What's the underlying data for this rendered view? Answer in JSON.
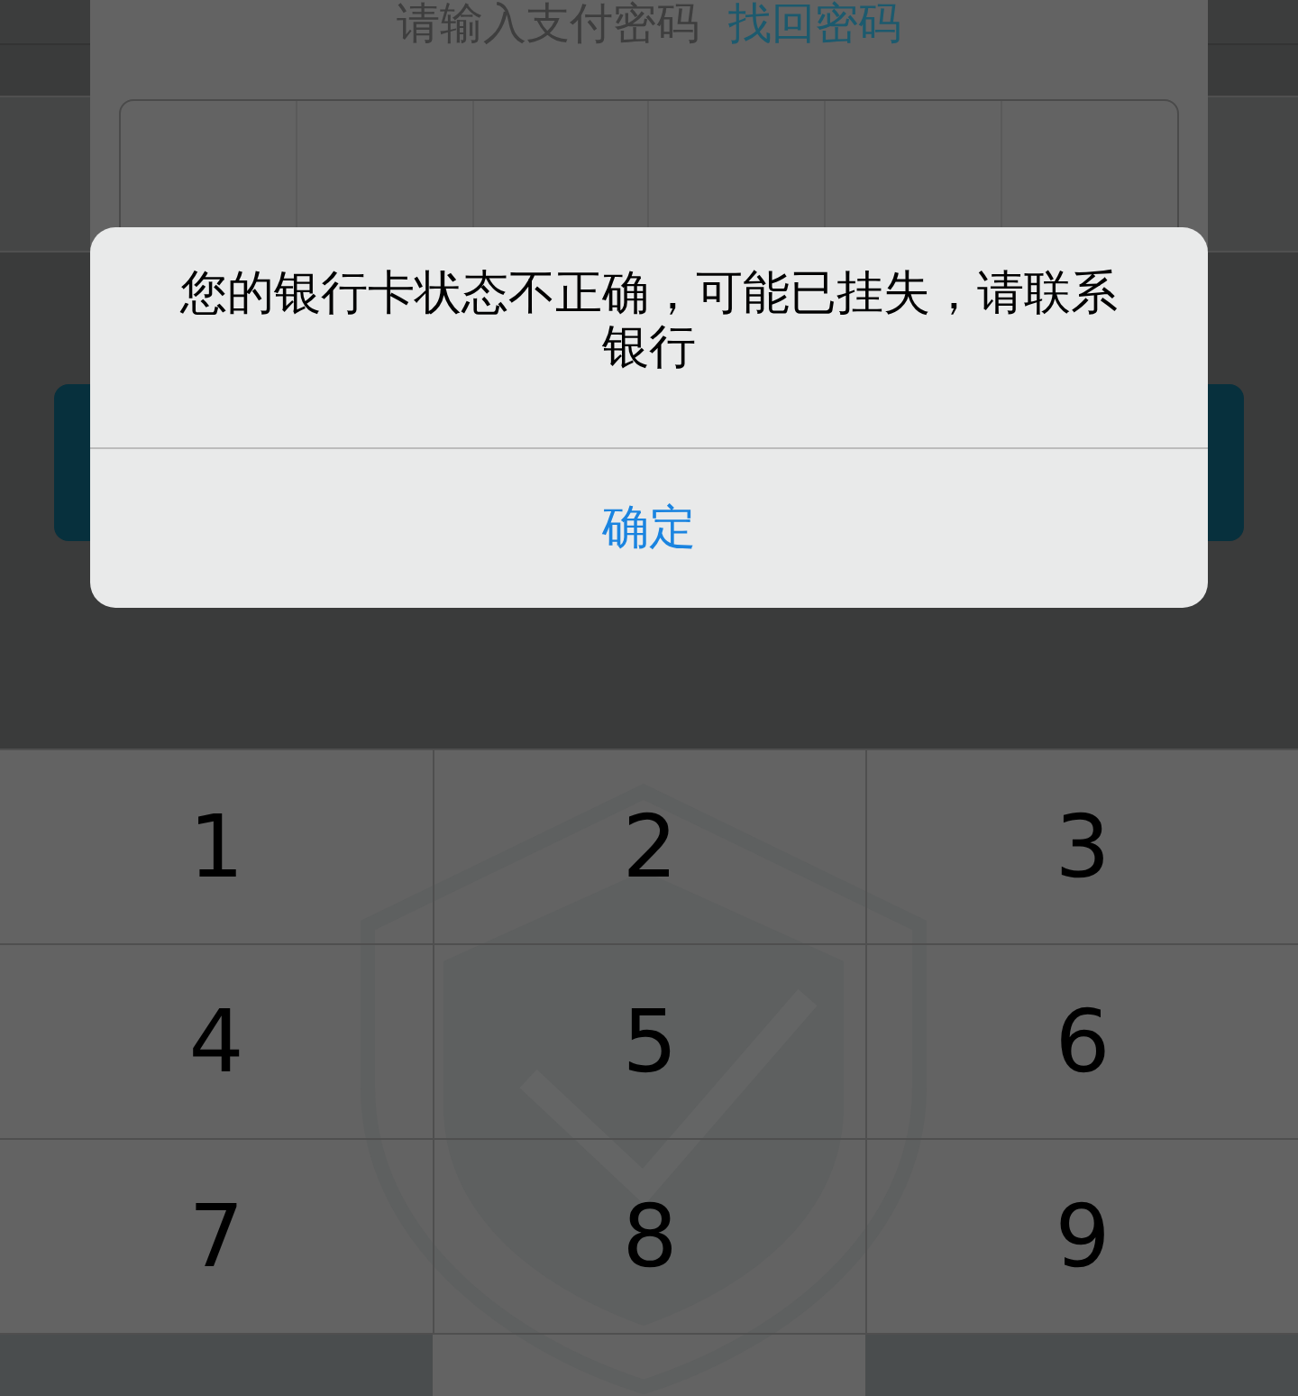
{
  "payment_sheet": {
    "title": "请输入支付密码",
    "recover_link": "找回密码"
  },
  "alert": {
    "message": "您的银行卡状态不正确，可能已挂失，请联系银行",
    "button": "确定"
  },
  "keypad": {
    "keys": [
      {
        "label": "1"
      },
      {
        "label": "2"
      },
      {
        "label": "3"
      },
      {
        "label": "4"
      },
      {
        "label": "5"
      },
      {
        "label": "6"
      },
      {
        "label": "7"
      },
      {
        "label": "8"
      },
      {
        "label": "9"
      }
    ],
    "bottom_keys": [
      {
        "kind": "function"
      },
      {
        "kind": "digit"
      },
      {
        "kind": "function"
      }
    ]
  }
}
